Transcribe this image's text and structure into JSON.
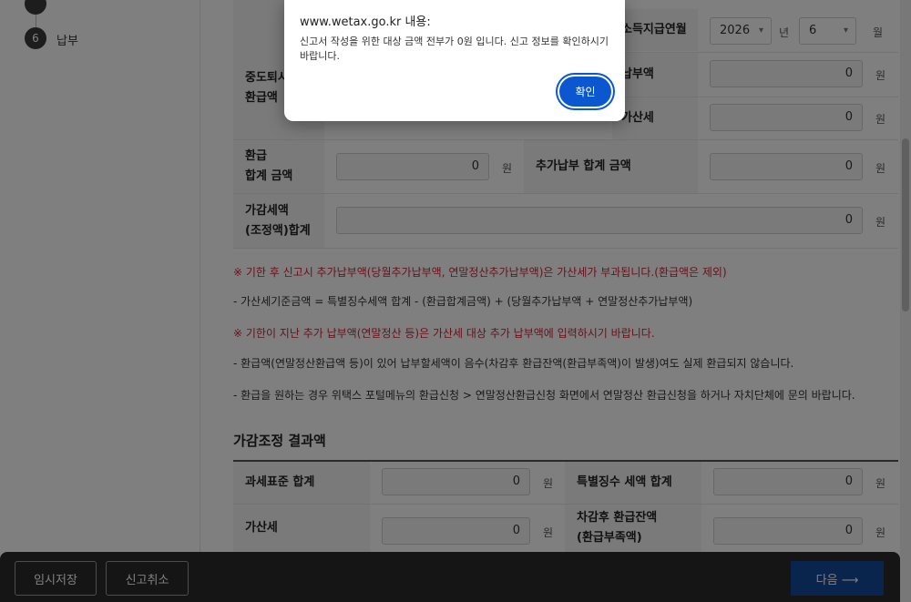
{
  "sidebar": {
    "step6": {
      "number": "6",
      "label": "납부"
    }
  },
  "top_table": {
    "midterm_refund_label_1": "중도퇴시",
    "midterm_refund_label_2": "환급액",
    "pay_year_month_label": "소득지급연월",
    "year_value": "2026",
    "year_unit": "년",
    "month_value": "6",
    "month_unit": "월",
    "extra_pay_label": "납부액",
    "extra_pay_value": "0",
    "penalty_label": "가산세",
    "penalty_value": "0",
    "won": "원"
  },
  "refund_total": {
    "label_1": "환급",
    "label_2": "합계 금액",
    "value": "0",
    "extra_total_label": "추가납부 합계 금액",
    "extra_total_value": "0"
  },
  "adjust_total": {
    "label_1": "가감세액",
    "label_2": "(조정액)합계",
    "value": "0"
  },
  "notes": [
    "※ 기한 후 신고시 추가납부액(당월추가납부액, 연말정산추가납부액)은 가산세가 부과됩니다.(환급액은 제외)",
    "- 가산세기준금액 = 특별징수세액 합계 - (환급합계금액) + (당월추가납부액 + 연말정산추가납부액)",
    "※ 기한이 지난 추가 납부액(연말정산 등)은 가산세 대상 추가 납부액에 입력하시기 바랍니다.",
    "- 환급액(연말정산환급액 등)이 있어 납부할세액이 음수(차감후 환급잔액(환급부족액)이 발생)여도 실제 환급되지 않습니다.",
    "- 환급을 원하는 경우 위택스 포털메뉴의 환급신청 > 연말정산환급신청 화면에서 연말정산 환급신청을 하거나 자치단체에 문의 바랍니다."
  ],
  "result": {
    "title": "가감조정 결과액",
    "tax_base_total_label": "과세표준 합계",
    "tax_base_total_value": "0",
    "special_tax_total_label": "특별징수 세액 합계",
    "special_tax_total_value": "0",
    "penalty_label": "가산세",
    "penalty_value": "0",
    "balance_label_1": "차감후 환급잔액",
    "balance_label_2": "(환급부족액)",
    "balance_value": "0",
    "won": "원"
  },
  "footer": {
    "temp_save": "임시저장",
    "cancel_report": "신고취소",
    "next": "다음 ⟶"
  },
  "dialog": {
    "title": "www.wetax.go.kr 내용:",
    "message": "신고서 작성을 위한 대상 금액 전부가 0원 입니다. 신고 정보를 확인하시기 바랍니다.",
    "ok": "확인",
    "ok_color": "#0b57d0"
  }
}
